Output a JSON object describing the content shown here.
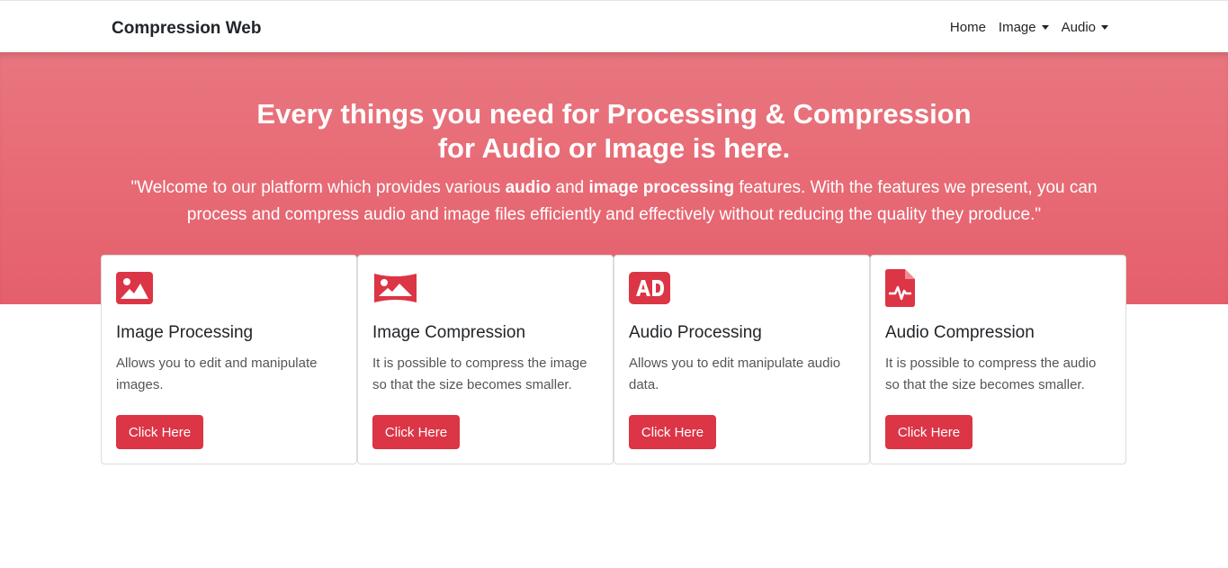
{
  "navbar": {
    "brand": "Compression Web",
    "items": [
      {
        "label": "Home"
      },
      {
        "label": "Image"
      },
      {
        "label": "Audio"
      }
    ]
  },
  "hero": {
    "title_line1": "Every things you need for Processing & Compression",
    "title_line2": "for Audio or Image is here.",
    "text_part1": "\"Welcome to our platform which provides various ",
    "text_bold1": "audio",
    "text_part2": " and ",
    "text_bold2": "image processing",
    "text_part3": " features. With the features we present, you can process and compress audio and image files efficiently and effectively without reducing the quality they produce.\""
  },
  "cards": [
    {
      "icon": "image-icon",
      "title": "Image Processing",
      "text": "Allows you to edit and manipulate images.",
      "button": "Click Here"
    },
    {
      "icon": "panorama-icon",
      "title": "Image Compression",
      "text": "It is possible to compress the image so that the size becomes smaller.",
      "button": "Click Here"
    },
    {
      "icon": "audio-description-icon",
      "title": "Audio Processing",
      "text": "Allows you to edit manipulate audio data.",
      "button": "Click Here"
    },
    {
      "icon": "file-medical-icon",
      "title": "Audio Compression",
      "text": "It is possible to compress the audio so that the size becomes smaller.",
      "button": "Click Here"
    }
  ],
  "colors": {
    "accent": "#dc3545",
    "hero_top": "#e9767f",
    "hero_bottom": "#e55f6c"
  }
}
